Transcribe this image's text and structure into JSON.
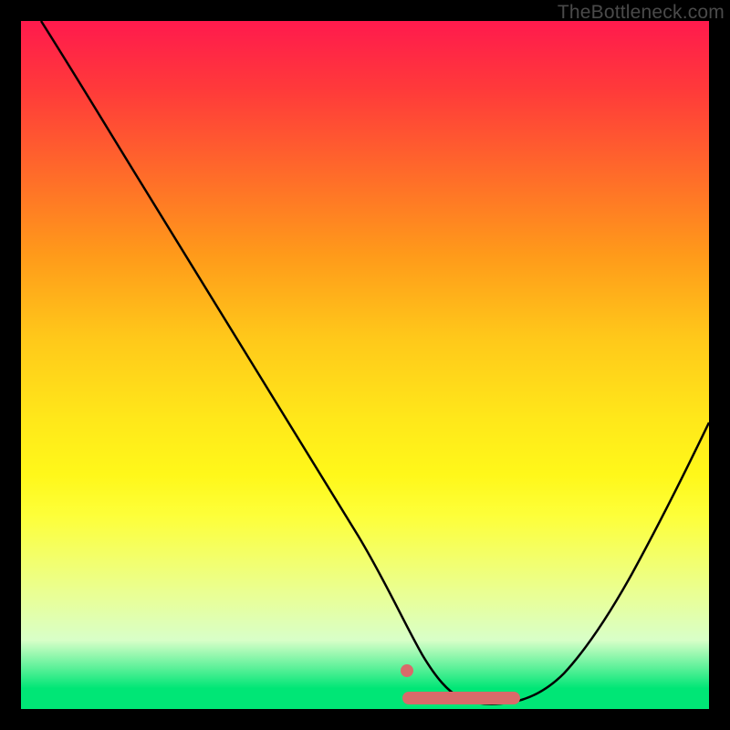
{
  "watermark": "TheBottleneck.com",
  "chart_data": {
    "type": "line",
    "title": "",
    "xlabel": "",
    "ylabel": "",
    "xlim": [
      0,
      100
    ],
    "ylim": [
      0,
      100
    ],
    "grid": false,
    "series": [
      {
        "name": "curve",
        "color": "#000000",
        "x": [
          3,
          8,
          14,
          20,
          26,
          32,
          38,
          44,
          50,
          53,
          56,
          59,
          62,
          65,
          68,
          71,
          74,
          78,
          82,
          86,
          90,
          94,
          98,
          100
        ],
        "values": [
          100,
          94,
          86,
          77,
          68,
          59,
          50,
          41,
          31,
          24,
          18,
          12,
          7,
          4,
          2,
          1,
          1.5,
          3,
          7,
          13,
          21,
          30,
          40,
          46
        ]
      }
    ],
    "highlight": {
      "name": "optimal-range",
      "color": "#e57373",
      "x_start": 56,
      "x_end": 72,
      "y": 1.5,
      "dot_x": 56,
      "dot_y": 6
    }
  }
}
